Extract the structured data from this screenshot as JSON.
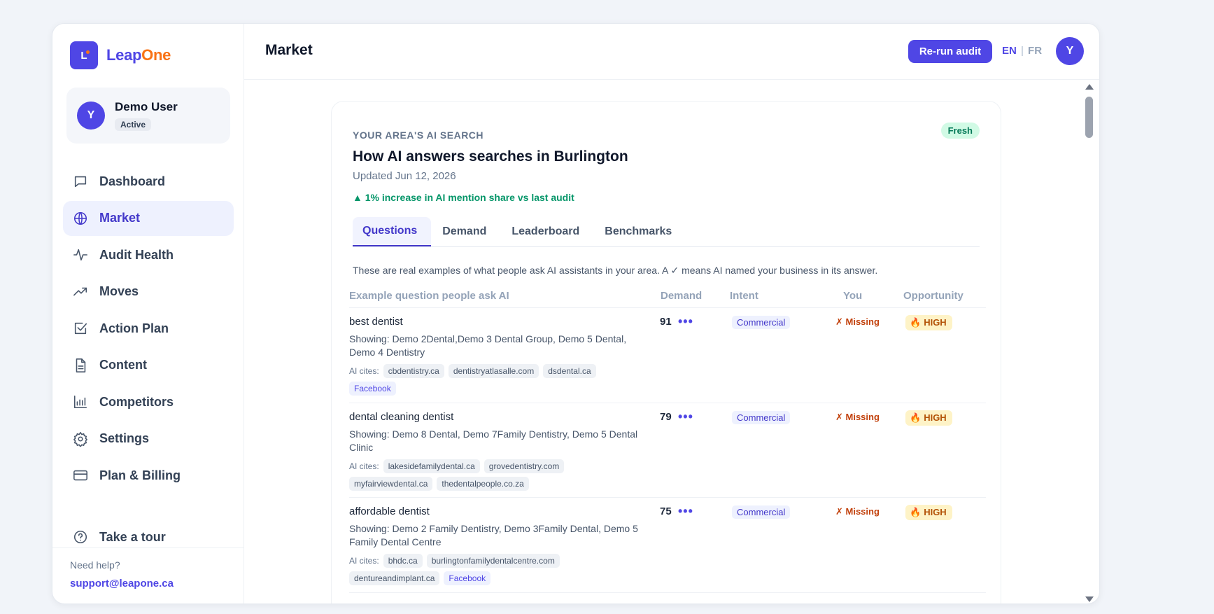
{
  "brand": {
    "name_part1": "Leap",
    "name_part2": "One",
    "mark": "L"
  },
  "user": {
    "initial": "Y",
    "name": "Demo User",
    "status": "Active"
  },
  "nav": [
    {
      "label": "Dashboard",
      "icon": "chat-icon"
    },
    {
      "label": "Market",
      "icon": "globe-icon"
    },
    {
      "label": "Audit Health",
      "icon": "pulse-icon"
    },
    {
      "label": "Moves",
      "icon": "trending-up-icon"
    },
    {
      "label": "Action Plan",
      "icon": "checkbox-icon"
    },
    {
      "label": "Content",
      "icon": "document-icon"
    },
    {
      "label": "Competitors",
      "icon": "bar-chart-icon"
    },
    {
      "label": "Settings",
      "icon": "gear-icon"
    },
    {
      "label": "Plan & Billing",
      "icon": "credit-card-icon"
    }
  ],
  "tour": {
    "label": "Take a tour",
    "icon": "help-circle-icon"
  },
  "help": {
    "label": "Need help?",
    "email": "support@leapone.ca"
  },
  "header": {
    "title": "Market",
    "rerun_label": "Re-run audit",
    "lang_en": "EN",
    "lang_sep": "|",
    "lang_fr": "FR",
    "avatar_initial": "Y"
  },
  "card": {
    "eyebrow": "YOUR AREA'S AI SEARCH",
    "badge": "Fresh",
    "title": "How AI answers searches in Burlington",
    "updated": "Updated Jun 12, 2026",
    "increase": "▲ 1% increase in AI mention share vs last audit",
    "tabs": [
      "Questions",
      "Demand",
      "Leaderboard",
      "Benchmarks"
    ],
    "note": "These are real examples of what people ask AI assistants in your area. A ✓ means AI named your business in its answer."
  },
  "table": {
    "headers": {
      "question": "Example question people ask AI",
      "demand": "Demand",
      "intent": "Intent",
      "you": "You",
      "opportunity": "Opportunity"
    },
    "cites_label": "AI cites:",
    "rows": [
      {
        "question": "best dentist",
        "showing": "Showing: Demo 2Dental,Demo 3 Dental Group, Demo 5 Dental, Demo 4 Dentistry",
        "cites": [
          "cbdentistry.ca",
          "dentistryatlasalle.com",
          "dsdental.ca"
        ],
        "social": "Facebook",
        "demand": "91",
        "dots": "•••",
        "intent": "Commercial",
        "you": "✗ Missing",
        "opportunity": "HIGH"
      },
      {
        "question": "dental cleaning dentist",
        "showing": "Showing: Demo 8 Dental, Demo 7Family Dentistry, Demo 5 Dental Clinic",
        "cites": [
          "lakesidefamilydental.ca",
          "grovedentistry.com",
          "myfairviewdental.ca",
          "thedentalpeople.co.za"
        ],
        "social": "",
        "demand": "79",
        "dots": "•••",
        "intent": "Commercial",
        "you": "✗ Missing",
        "opportunity": "HIGH"
      },
      {
        "question": "affordable dentist",
        "showing": "Showing: Demo 2 Family Dentistry, Demo 3Family Dental, Demo 5 Family Dental Centre",
        "cites": [
          "bhdc.ca",
          "burlingtonfamilydentalcentre.com",
          "dentureandimplant.ca"
        ],
        "social": "Facebook",
        "demand": "75",
        "dots": "•••",
        "intent": "Commercial",
        "you": "✗ Missing",
        "opportunity": "HIGH"
      }
    ]
  }
}
